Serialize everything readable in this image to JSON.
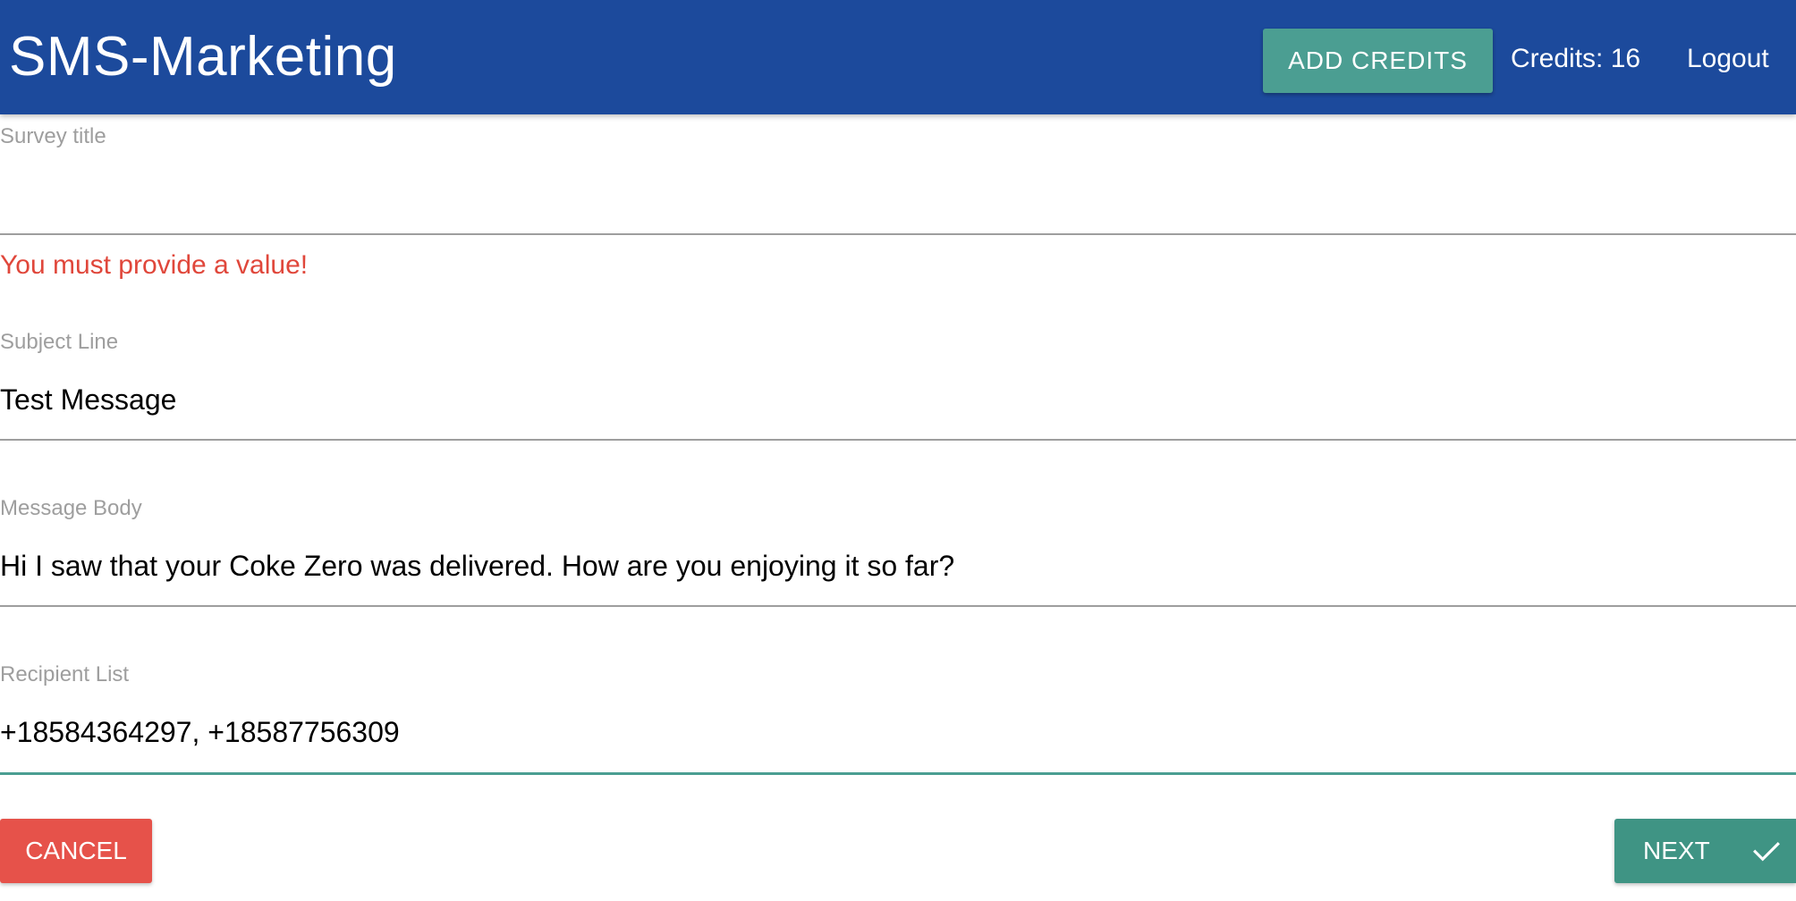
{
  "header": {
    "brand": "SMS-Marketing",
    "add_credits_label": "ADD CREDITS",
    "credits_text": "Credits: 16",
    "logout_label": "Logout"
  },
  "form": {
    "survey_title": {
      "label": "Survey title",
      "value": ""
    },
    "survey_title_error": "You must provide a value!",
    "subject_line": {
      "label": "Subject Line",
      "value": "Test Message"
    },
    "message_body": {
      "label": "Message Body",
      "value": "Hi I saw that your Coke Zero was delivered. How are you enjoying it so far?"
    },
    "recipient_list": {
      "label": "Recipient List",
      "value": "+18584364297, +18587756309"
    }
  },
  "actions": {
    "cancel_label": "CANCEL",
    "next_label": "NEXT",
    "next_icon": "check-icon"
  },
  "colors": {
    "header_bg": "#1c4a9c",
    "accent_teal": "#4b9e92",
    "error_red": "#e0473b",
    "cancel_red": "#e6524a"
  }
}
